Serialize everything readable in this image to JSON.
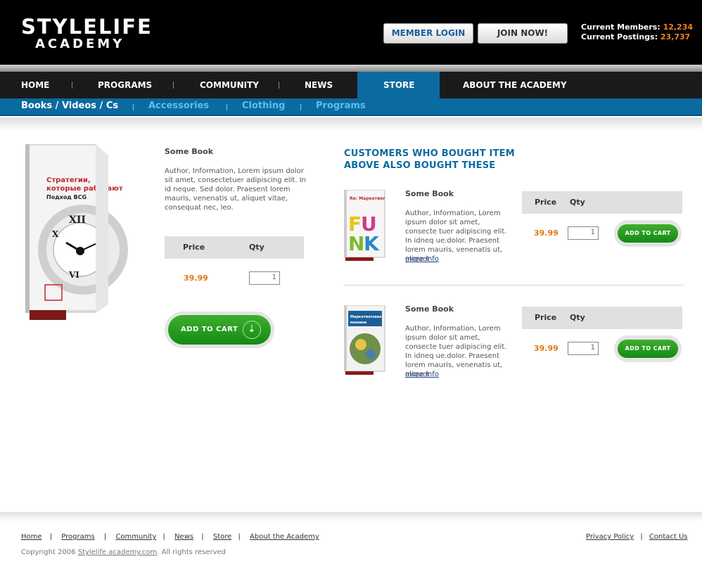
{
  "brand": {
    "line1": "STYLELIFE",
    "line2": "ACADEMY"
  },
  "header": {
    "member_login": "MEMBER  LOGIN",
    "join_now": "JOIN NOW!",
    "members_label": "Current Members:",
    "members_value": "12,234",
    "postings_label": "Current Postings:",
    "postings_value": "23,737"
  },
  "nav": {
    "items": [
      "HOME",
      "PROGRAMS",
      "COMMUNITY",
      "NEWS",
      "STORE",
      "ABOUT THE ACADEMY"
    ],
    "active": "STORE"
  },
  "subnav": {
    "items": [
      "Books / Videos / Cs",
      "Accessories",
      "Clothing",
      "Programs"
    ],
    "active": "Books / Videos / Cs"
  },
  "product": {
    "cover_title": "Стратегии, которые работают",
    "cover_subtitle": "Подход BCG",
    "title": "Some Book",
    "description": "Author, Information, Lorem ipsum dolor sit amet, consectetuer adipiscing elit. In id neque. Sed dolor. Praesent lorem mauris, venenatis ut, aliquet vitae, consequat nec, leo.",
    "price_label": "Price",
    "qty_label": "Qty",
    "price": "39.99",
    "qty": "1",
    "cart_label": "ADD TO CART"
  },
  "related": {
    "heading_line1": "CUSTOMERS WHO BOUGHT ITEM",
    "heading_line2": "ABOVE ALSO BOUGHT THESE",
    "items": [
      {
        "title": "Some Book",
        "description": "Author, Information, Lorem ipsum dolor sit amet, consecte tuer adipiscing elit. In idneq ue.dolor. Praesent lorem mauris, venenatis ut, aliquet",
        "more": "more info",
        "price_label": "Price",
        "qty_label": "Qty",
        "price": "39.99",
        "qty": "1",
        "cart_label": "ADD TO CART",
        "cover_text": "FUNK"
      },
      {
        "title": "Some Book",
        "description": "Author, Information, Lorem ipsum dolor sit amet, consecte tuer adipiscing elit. In idneq ue.dolor. Praesent lorem mauris, venenatis ut, aliquet",
        "more": "more info",
        "price_label": "Price",
        "qty_label": "Qty",
        "price": "39.99",
        "qty": "1",
        "cart_label": "ADD TO CART",
        "cover_text": "Маркетинговая машина"
      }
    ]
  },
  "footer": {
    "links": [
      "Home",
      "Programs",
      "Community",
      "News",
      "Store",
      "About the Academy"
    ],
    "right_links": [
      "Privacy Policy",
      "Contact Us"
    ],
    "copyright_prefix": "Copyright 2006",
    "copyright_site": "Stylelife academy.com",
    "copyright_suffix": ".  All rights reserved"
  },
  "colors": {
    "nav_blue": "#0b6aa0",
    "price_orange": "#e07812",
    "cart_green": "#2a9c20"
  }
}
